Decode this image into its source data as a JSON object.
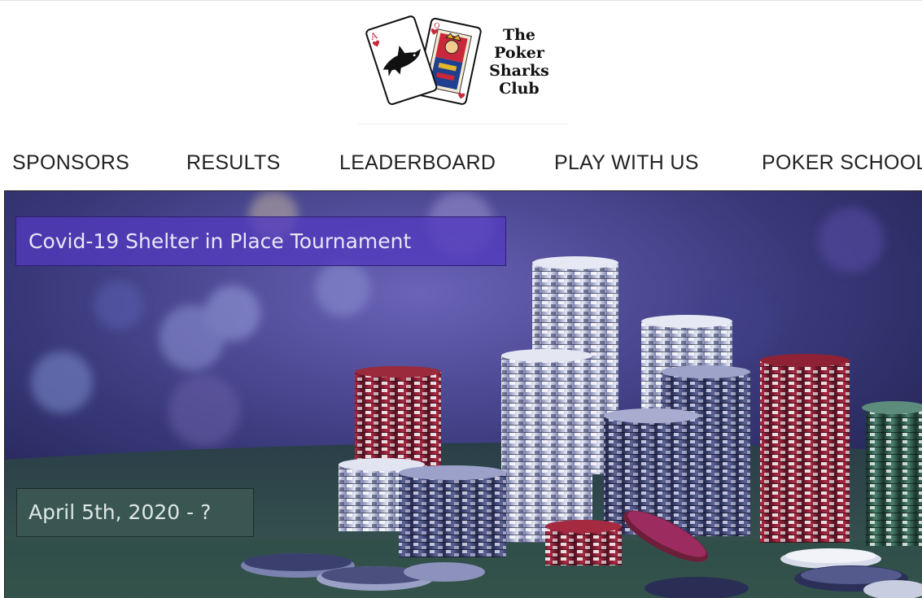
{
  "logo": {
    "lines": [
      "The",
      "Poker",
      "Sharks",
      "Club"
    ]
  },
  "nav": {
    "items": [
      {
        "label": "SPONSORS"
      },
      {
        "label": "RESULTS"
      },
      {
        "label": "LEADERBOARD"
      },
      {
        "label": "PLAY WITH US"
      },
      {
        "label": "POKER SCHOOL"
      }
    ]
  },
  "hero": {
    "title": "Covid-19 Shelter in Place Tournament",
    "date": "April 5th, 2020 - ?"
  },
  "colors": {
    "title_banner": "#523abe",
    "date_banner": "#3c5854",
    "felt": "#2f4a46",
    "chip_red": "#8a1f33",
    "chip_blue": "#5a5f93"
  }
}
